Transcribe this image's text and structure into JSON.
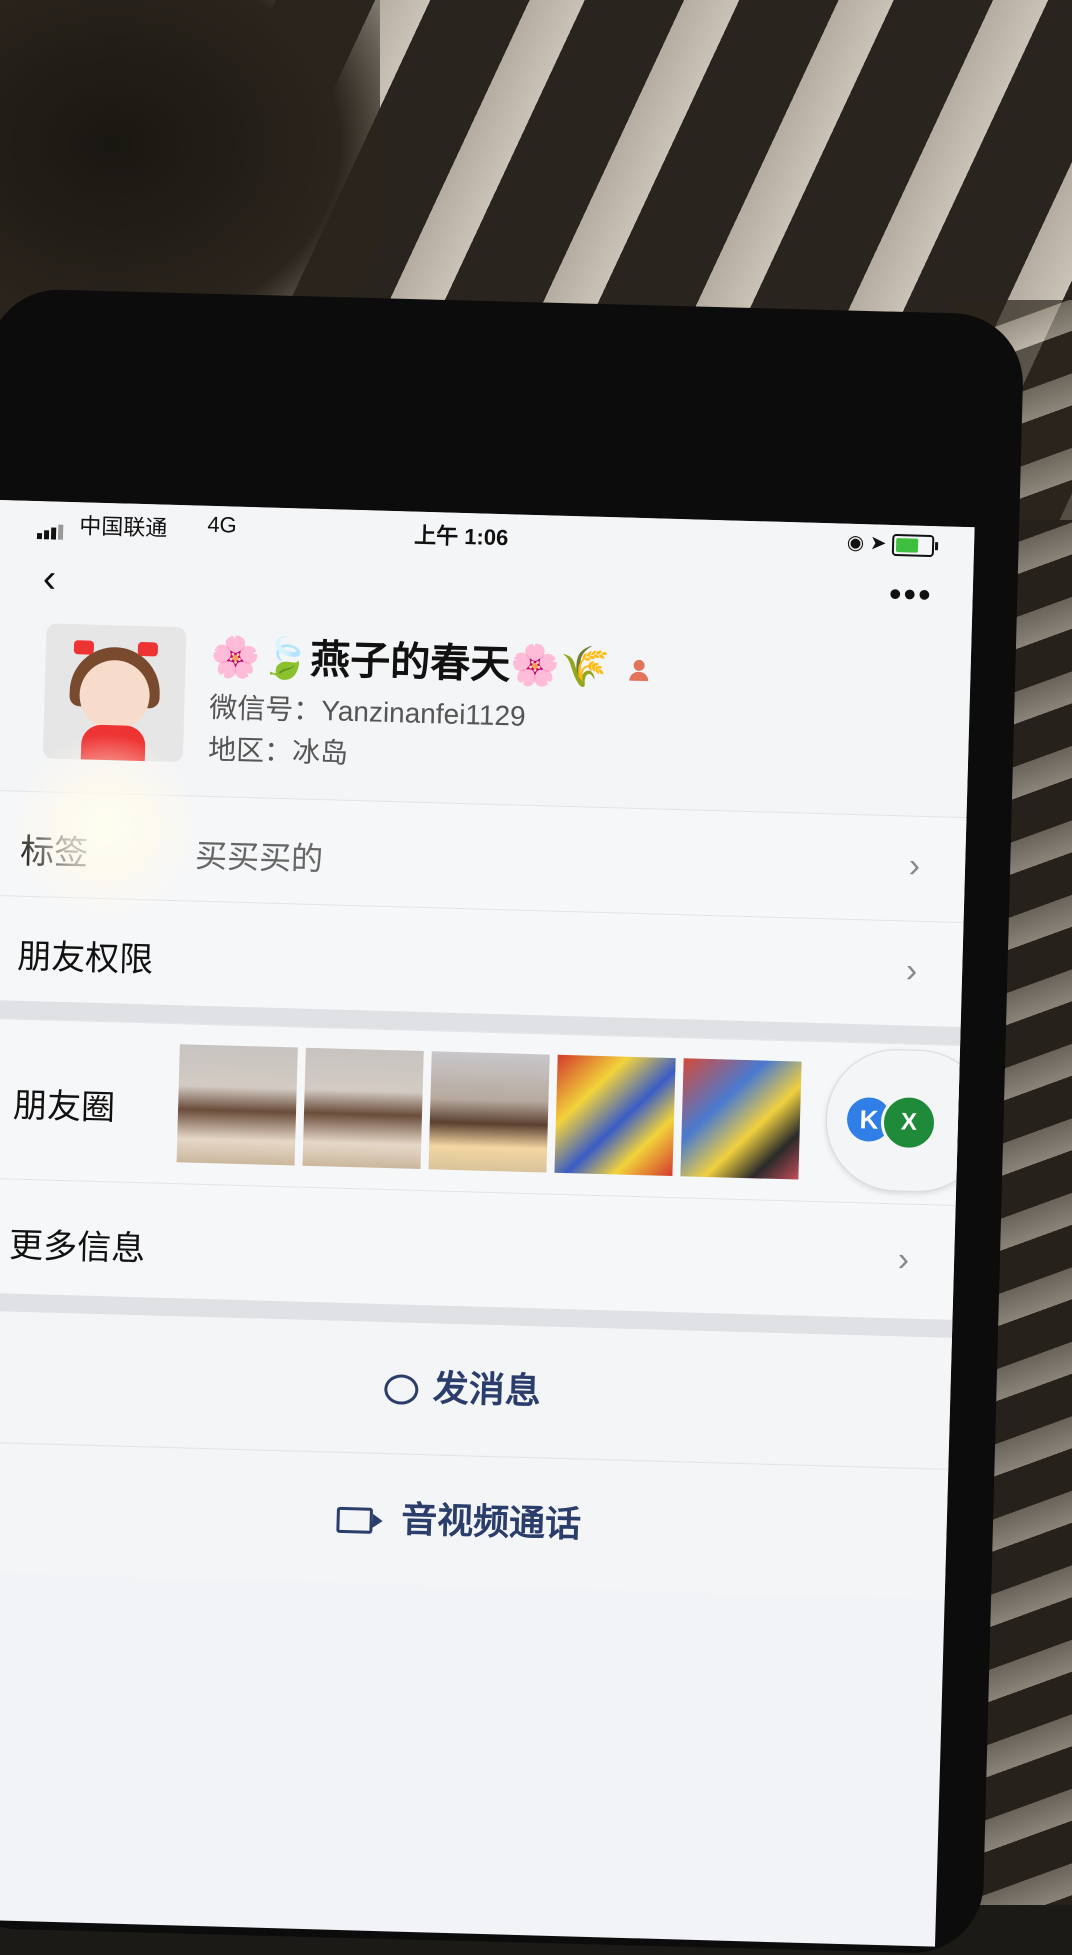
{
  "status_bar": {
    "carrier": "中国联通",
    "network": "4G",
    "time": "上午 1:06"
  },
  "nav": {
    "back_icon": "chevron-left-icon",
    "more_label": "•••"
  },
  "profile": {
    "nickname_prefix": "🌸🍃",
    "nickname": "燕子的春天",
    "nickname_suffix": "🌸🌾",
    "wechat_id": "微信号：Yanzinanfei1129",
    "region": "地区：冰岛"
  },
  "cells": {
    "tags_label": "标签",
    "tags_value": "买买买的",
    "friend_permissions_label": "朋友权限",
    "moments_label": "朋友圈",
    "more_info_label": "更多信息"
  },
  "floating_bubble": {
    "left_badge": "K",
    "right_badge": "X"
  },
  "actions": {
    "send_message": "发消息",
    "video_call": "音视频通话"
  },
  "colors": {
    "action_text": "#2a3d6b",
    "screen_bg": "#f4f5f7",
    "separator": "#dfe1e5"
  }
}
